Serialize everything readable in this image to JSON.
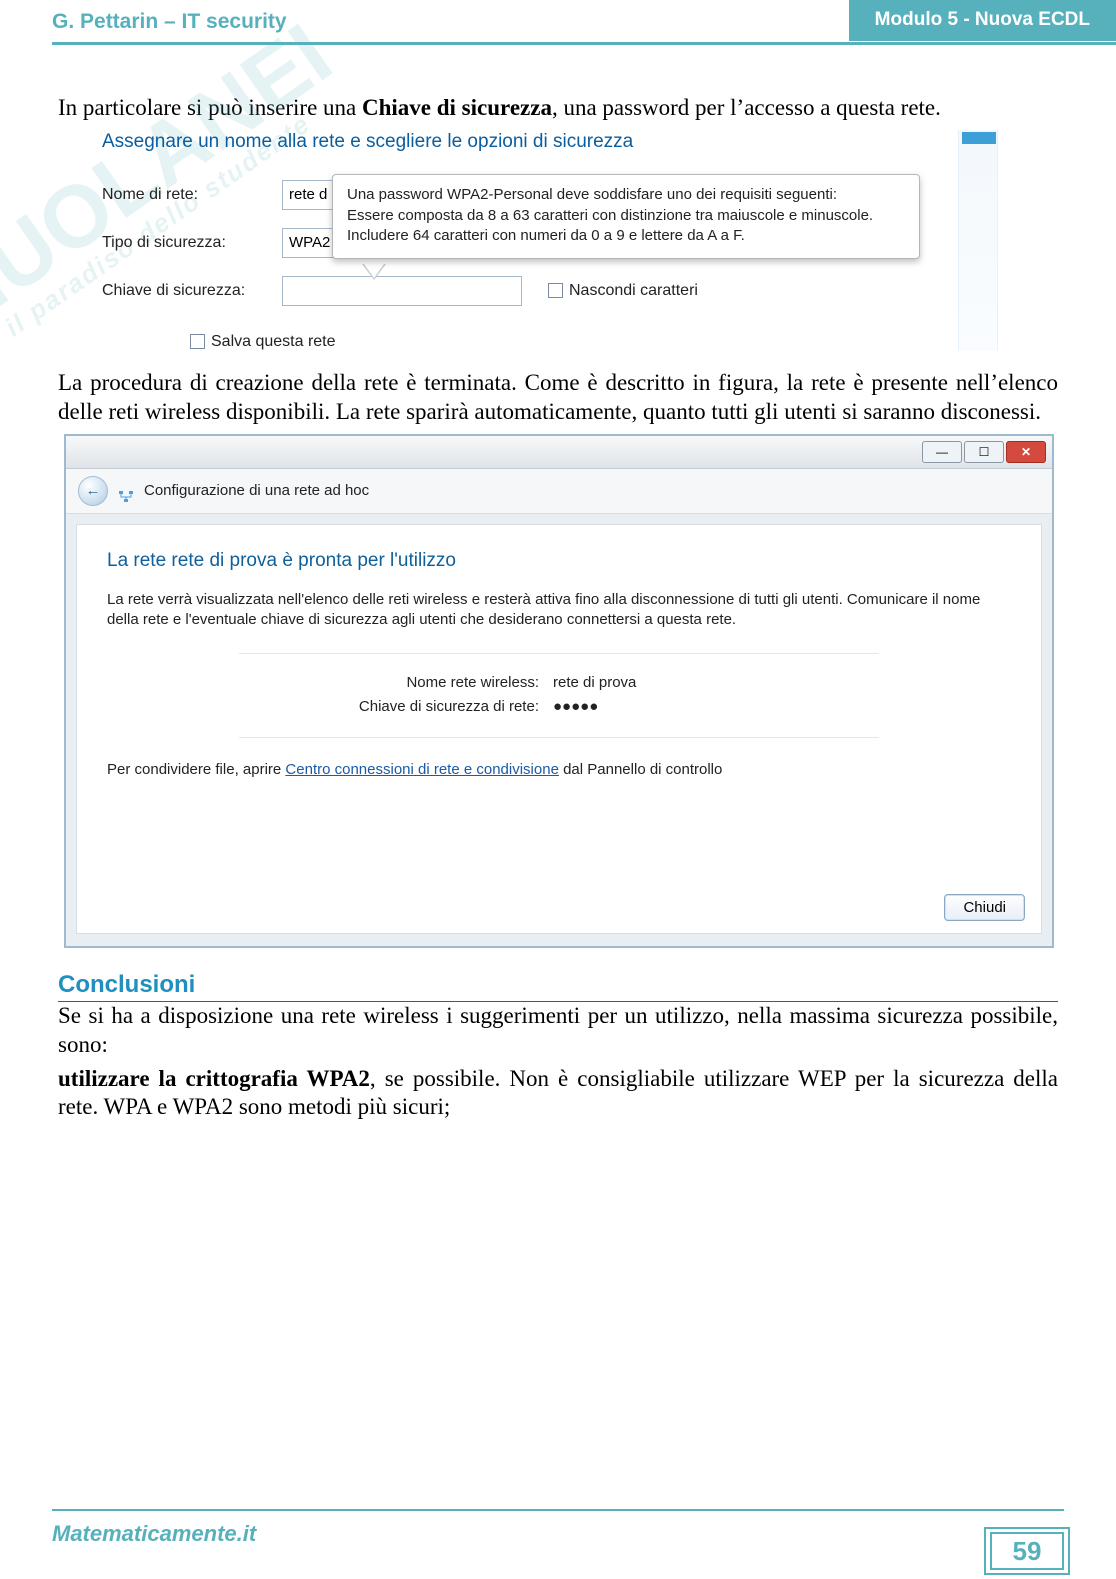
{
  "header": {
    "left": "G. Pettarin – IT security",
    "right": "Modulo 5 - Nuova ECDL"
  },
  "watermark": {
    "main": "SIUOLANEI",
    "sub": "il paradiso dello studente"
  },
  "para1_pre": " In particolare si può inserire una ",
  "para1_bold": "Chiave di sicurezza",
  "para1_post": ", una password per l’accesso a questa rete.",
  "shot1": {
    "title": "Assegnare un nome alla rete e scegliere le opzioni di sicurezza",
    "label_netname": "Nome di rete:",
    "value_netname": "rete d",
    "label_sectype": "Tipo di sicurezza:",
    "value_sectype": "WPA2",
    "label_key": "Chiave di sicurezza:",
    "value_key": "",
    "hide_chars": "Nascondi caratteri",
    "save_net": "Salva questa rete",
    "tooltip_l1": "Una password WPA2-Personal deve soddisfare uno dei requisiti seguenti:",
    "tooltip_l2": "Essere composta da 8 a 63 caratteri con distinzione tra maiuscole e minuscole.",
    "tooltip_l3": "Includere 64 caratteri con numeri da 0 a 9 e lettere da A a F."
  },
  "para2": "La procedura di creazione della rete è terminata. Come è descritto in figura, la rete è presente nell’elenco delle reti wireless disponibili. La rete sparirà automaticamente, quanto tutti gli utenti si saranno disconessi.",
  "shot2": {
    "nav_title": "Configurazione di una rete ad hoc",
    "heading": "La rete rete di prova è pronta per l'utilizzo",
    "desc": "La rete verrà visualizzata nell'elenco delle reti wireless e resterà attiva fino alla disconnessione di tutti gli utenti. Comunicare il nome della rete e l'eventuale chiave di sicurezza agli utenti che desiderano connettersi a questa rete.",
    "kv_name_label": "Nome rete wireless:",
    "kv_name_value": "rete di prova",
    "kv_key_label": "Chiave di sicurezza di rete:",
    "kv_key_value": "●●●●●",
    "share_pre": "Per condividere file, aprire ",
    "share_link": "Centro connessioni di rete e condivisione",
    "share_post": " dal Pannello di controllo",
    "close_btn": "Chiudi"
  },
  "conclusioni_h": "Conclusioni",
  "conc_p1": "Se si ha a disposizione una rete wireless i suggerimenti per un utilizzo, nella massima sicurezza possibile, sono:",
  "conc_b": "utilizzare la crittografia WPA2",
  "conc_p2": ", se possibile. Non è consigliabile utilizzare WEP per la sicurezza della rete. WPA e WPA2 sono metodi più sicuri;",
  "footer": {
    "brand": "Matematicamente.it",
    "page": "59"
  }
}
